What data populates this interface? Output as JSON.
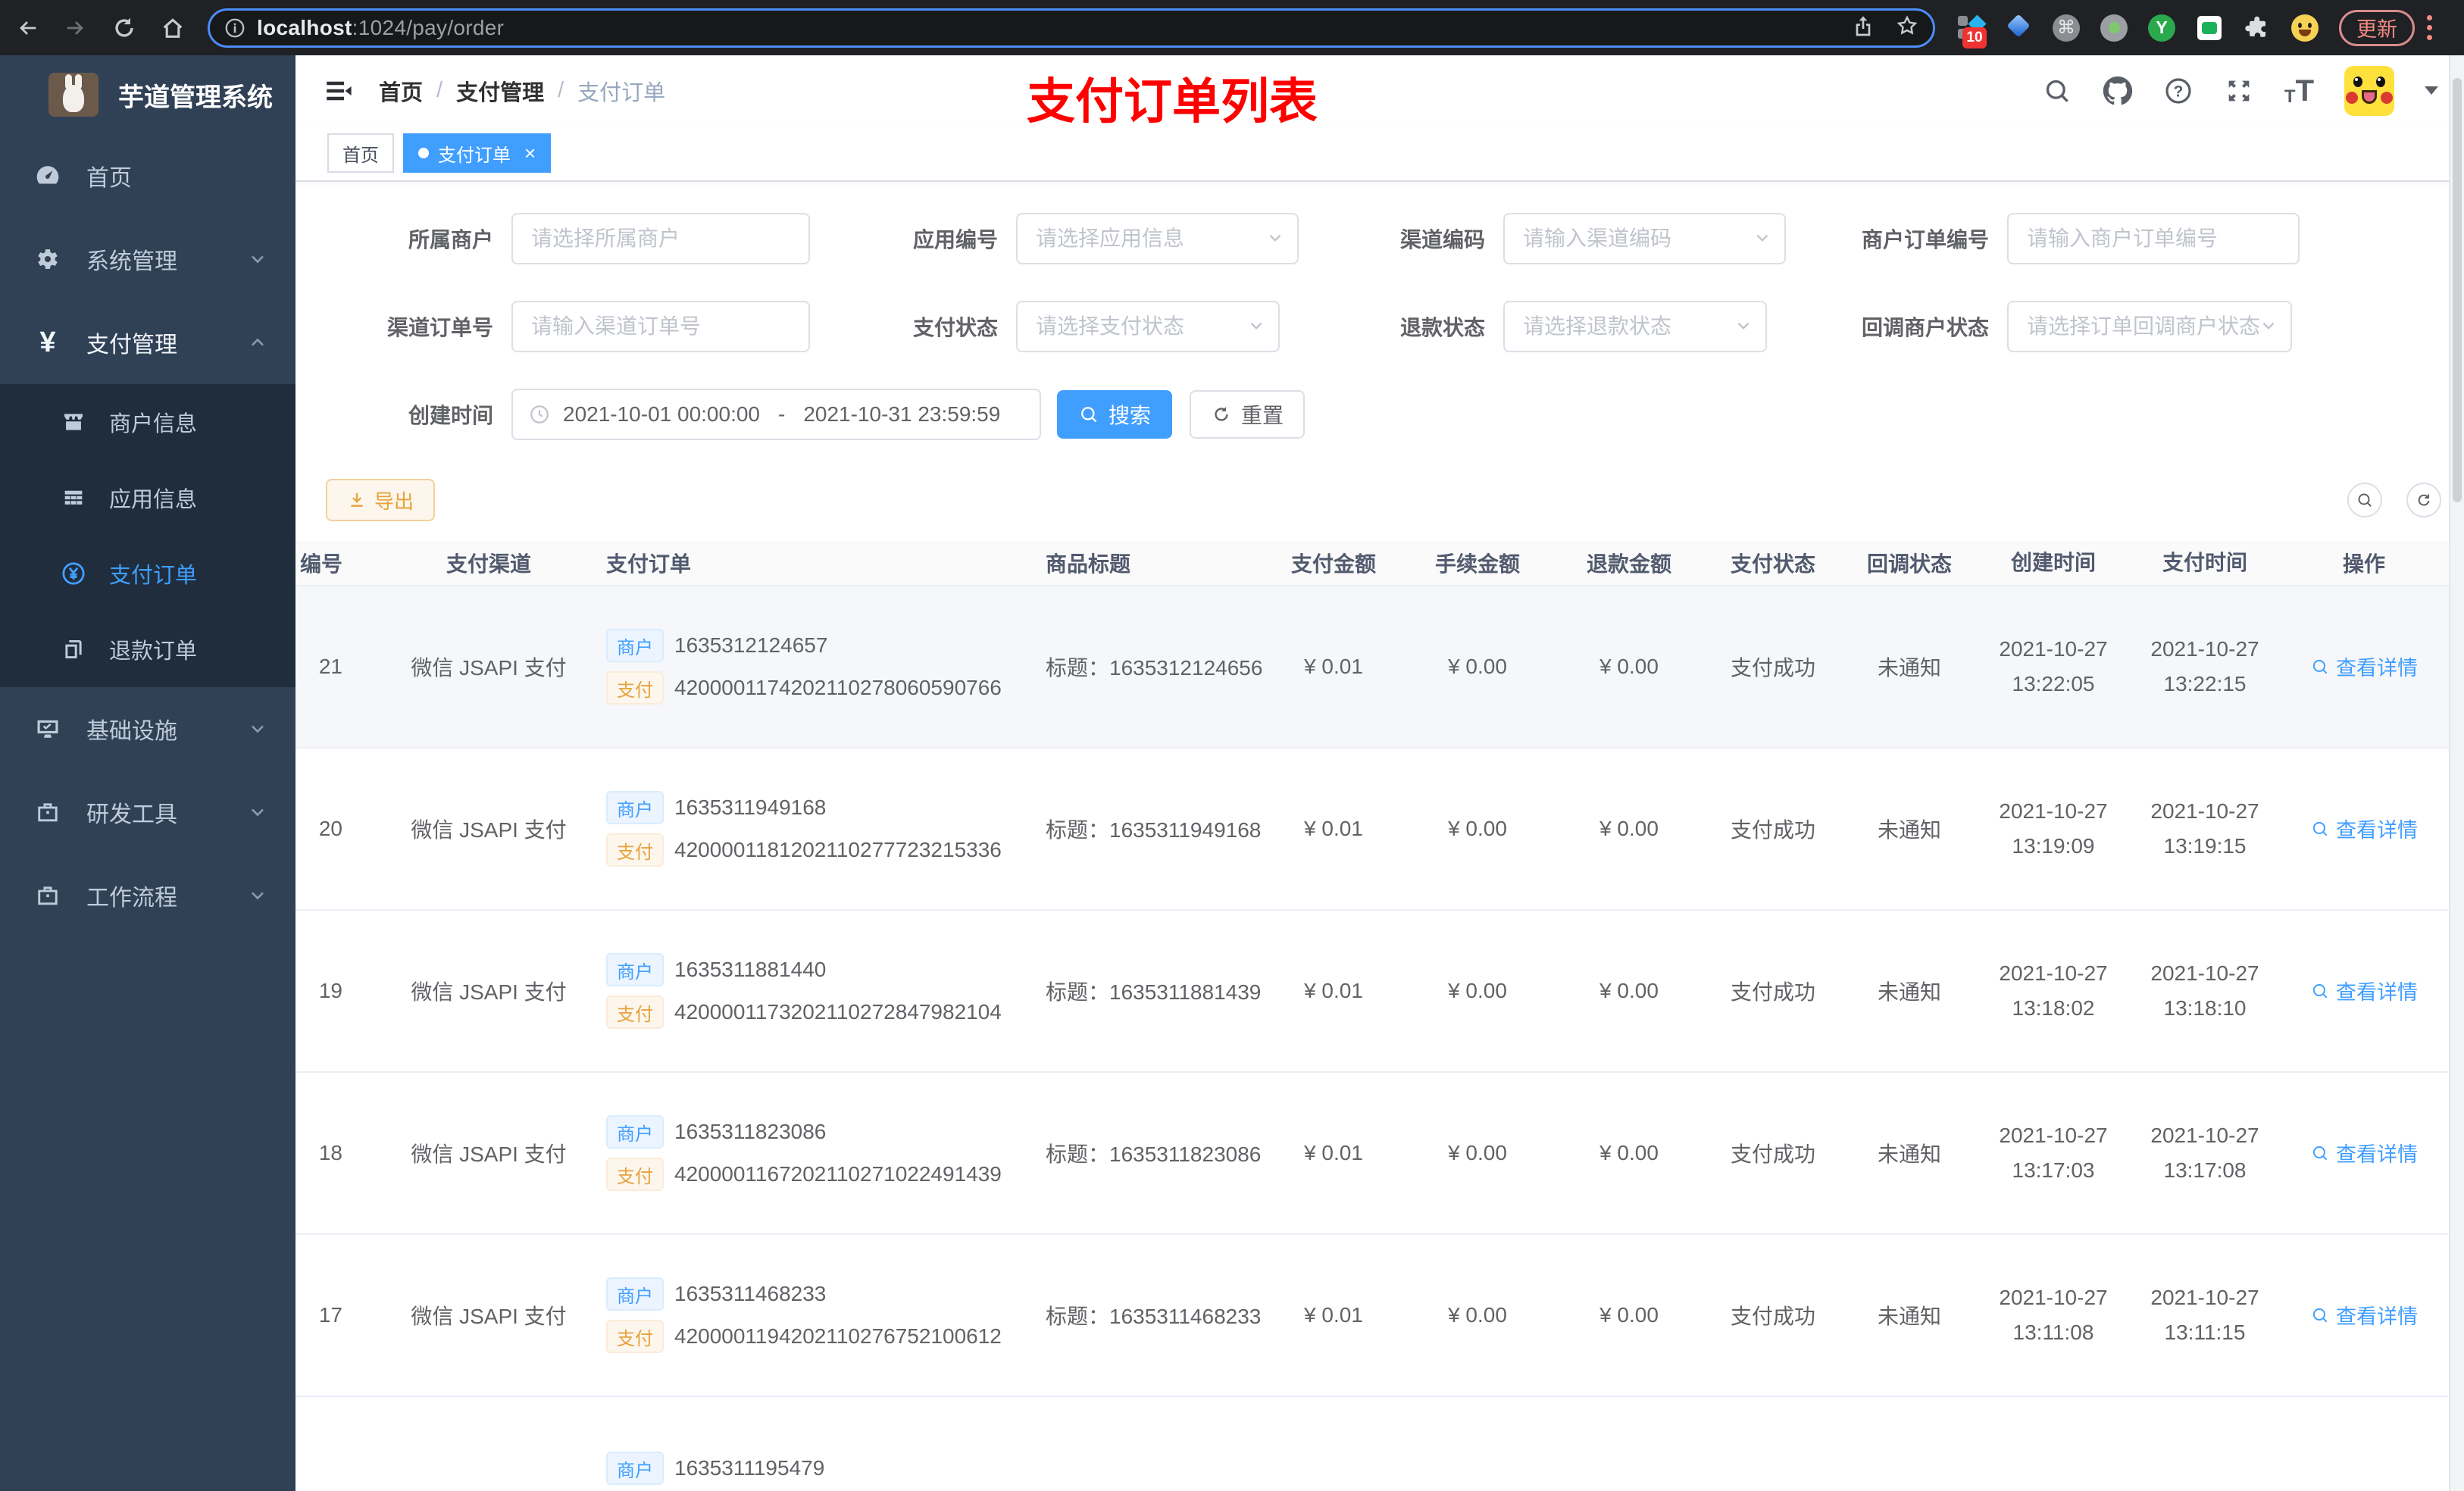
{
  "browser": {
    "url_host": "localhost",
    "url_path": ":1024/pay/order",
    "ext_badge": "10",
    "update_label": "更新"
  },
  "sidebar": {
    "app_title": "芋道管理系统",
    "items": [
      {
        "key": "home",
        "label": "首页",
        "icon": "dashboard-icon"
      },
      {
        "key": "system",
        "label": "系统管理",
        "icon": "gear-icon",
        "chevron": "down"
      },
      {
        "key": "payment",
        "label": "支付管理",
        "icon": "yen-icon",
        "chevron": "up",
        "expanded": true,
        "children": [
          {
            "key": "merchant-info",
            "label": "商户信息",
            "icon": "storefront-icon"
          },
          {
            "key": "app-info",
            "label": "应用信息",
            "icon": "grid-icon"
          },
          {
            "key": "pay-order",
            "label": "支付订单",
            "icon": "pay-order-icon",
            "active": true
          },
          {
            "key": "refund-order",
            "label": "退款订单",
            "icon": "refund-icon"
          }
        ]
      },
      {
        "key": "infra",
        "label": "基础设施",
        "icon": "monitor-icon",
        "chevron": "down"
      },
      {
        "key": "devtools",
        "label": "研发工具",
        "icon": "briefcase-icon",
        "chevron": "down"
      },
      {
        "key": "workflow",
        "label": "工作流程",
        "icon": "briefcase-icon",
        "chevron": "down"
      }
    ]
  },
  "header": {
    "breadcrumb": {
      "0": "首页",
      "1": "支付管理",
      "2": "支付订单",
      "sep": "/"
    },
    "annotation": "支付订单列表"
  },
  "tabs": {
    "0": {
      "label": "首页",
      "active": false
    },
    "1": {
      "label": "支付订单",
      "active": true,
      "close": "×"
    }
  },
  "filters": {
    "merchant": {
      "label": "所属商户",
      "placeholder": "请选择所属商户"
    },
    "app": {
      "label": "应用编号",
      "placeholder": "请选择应用信息"
    },
    "channel_code": {
      "label": "渠道编码",
      "placeholder": "请输入渠道编码"
    },
    "merchant_order_no": {
      "label": "商户订单编号",
      "placeholder": "请输入商户订单编号"
    },
    "channel_order_no": {
      "label": "渠道订单号",
      "placeholder": "请输入渠道订单号"
    },
    "pay_status": {
      "label": "支付状态",
      "placeholder": "请选择支付状态"
    },
    "refund_status": {
      "label": "退款状态",
      "placeholder": "请选择退款状态"
    },
    "notify_status": {
      "label": "回调商户状态",
      "placeholder": "请选择订单回调商户状态"
    },
    "create_time": {
      "label": "创建时间",
      "start": "2021-10-01 00:00:00",
      "separator": "-",
      "end": "2021-10-31 23:59:59"
    },
    "search_label": "搜索",
    "reset_label": "重置"
  },
  "toolbar": {
    "export_label": "导出"
  },
  "table": {
    "columns": [
      "编号",
      "支付渠道",
      "支付订单",
      "商品标题",
      "支付金额",
      "手续金额",
      "退款金额",
      "支付状态",
      "回调状态",
      "创建时间",
      "支付时间",
      "操作"
    ],
    "tags": {
      "merchant": "商户",
      "pay": "支付"
    },
    "rows": [
      {
        "id": "21",
        "channel": "微信 JSAPI 支付",
        "merchant_no": "1635312124657",
        "channel_no": "4200001174202110278060590766",
        "title": "标题：1635312124656",
        "amount": "¥ 0.01",
        "fee": "¥ 0.00",
        "refund": "¥ 0.00",
        "pay_status": "支付成功",
        "notify_status": "未通知",
        "create_date": "2021-10-27",
        "create_time": "13:22:05",
        "pay_date": "2021-10-27",
        "pay_time": "13:22:15",
        "action": "查看详情",
        "hover": true
      },
      {
        "id": "20",
        "channel": "微信 JSAPI 支付",
        "merchant_no": "1635311949168",
        "channel_no": "4200001181202110277723215336",
        "title": "标题：1635311949168",
        "amount": "¥ 0.01",
        "fee": "¥ 0.00",
        "refund": "¥ 0.00",
        "pay_status": "支付成功",
        "notify_status": "未通知",
        "create_date": "2021-10-27",
        "create_time": "13:19:09",
        "pay_date": "2021-10-27",
        "pay_time": "13:19:15",
        "action": "查看详情",
        "hover": false
      },
      {
        "id": "19",
        "channel": "微信 JSAPI 支付",
        "merchant_no": "1635311881440",
        "channel_no": "4200001173202110272847982104",
        "title": "标题：1635311881439",
        "amount": "¥ 0.01",
        "fee": "¥ 0.00",
        "refund": "¥ 0.00",
        "pay_status": "支付成功",
        "notify_status": "未通知",
        "create_date": "2021-10-27",
        "create_time": "13:18:02",
        "pay_date": "2021-10-27",
        "pay_time": "13:18:10",
        "action": "查看详情",
        "hover": false
      },
      {
        "id": "18",
        "channel": "微信 JSAPI 支付",
        "merchant_no": "1635311823086",
        "channel_no": "4200001167202110271022491439",
        "title": "标题：1635311823086",
        "amount": "¥ 0.01",
        "fee": "¥ 0.00",
        "refund": "¥ 0.00",
        "pay_status": "支付成功",
        "notify_status": "未通知",
        "create_date": "2021-10-27",
        "create_time": "13:17:03",
        "pay_date": "2021-10-27",
        "pay_time": "13:17:08",
        "action": "查看详情",
        "hover": false
      },
      {
        "id": "17",
        "channel": "微信 JSAPI 支付",
        "merchant_no": "1635311468233",
        "channel_no": "4200001194202110276752100612",
        "title": "标题：1635311468233",
        "amount": "¥ 0.01",
        "fee": "¥ 0.00",
        "refund": "¥ 0.00",
        "pay_status": "支付成功",
        "notify_status": "未通知",
        "create_date": "2021-10-27",
        "create_time": "13:11:08",
        "pay_date": "2021-10-27",
        "pay_time": "13:11:15",
        "action": "查看详情",
        "hover": false
      },
      {
        "id": "",
        "channel": "",
        "merchant_no": "1635311195479",
        "channel_no": "",
        "title": "",
        "amount": "",
        "fee": "",
        "refund": "",
        "pay_status": "",
        "notify_status": "",
        "create_date": "",
        "create_time": "",
        "pay_date": "",
        "pay_time": "",
        "action": "",
        "hover": false,
        "partial": true
      }
    ]
  }
}
